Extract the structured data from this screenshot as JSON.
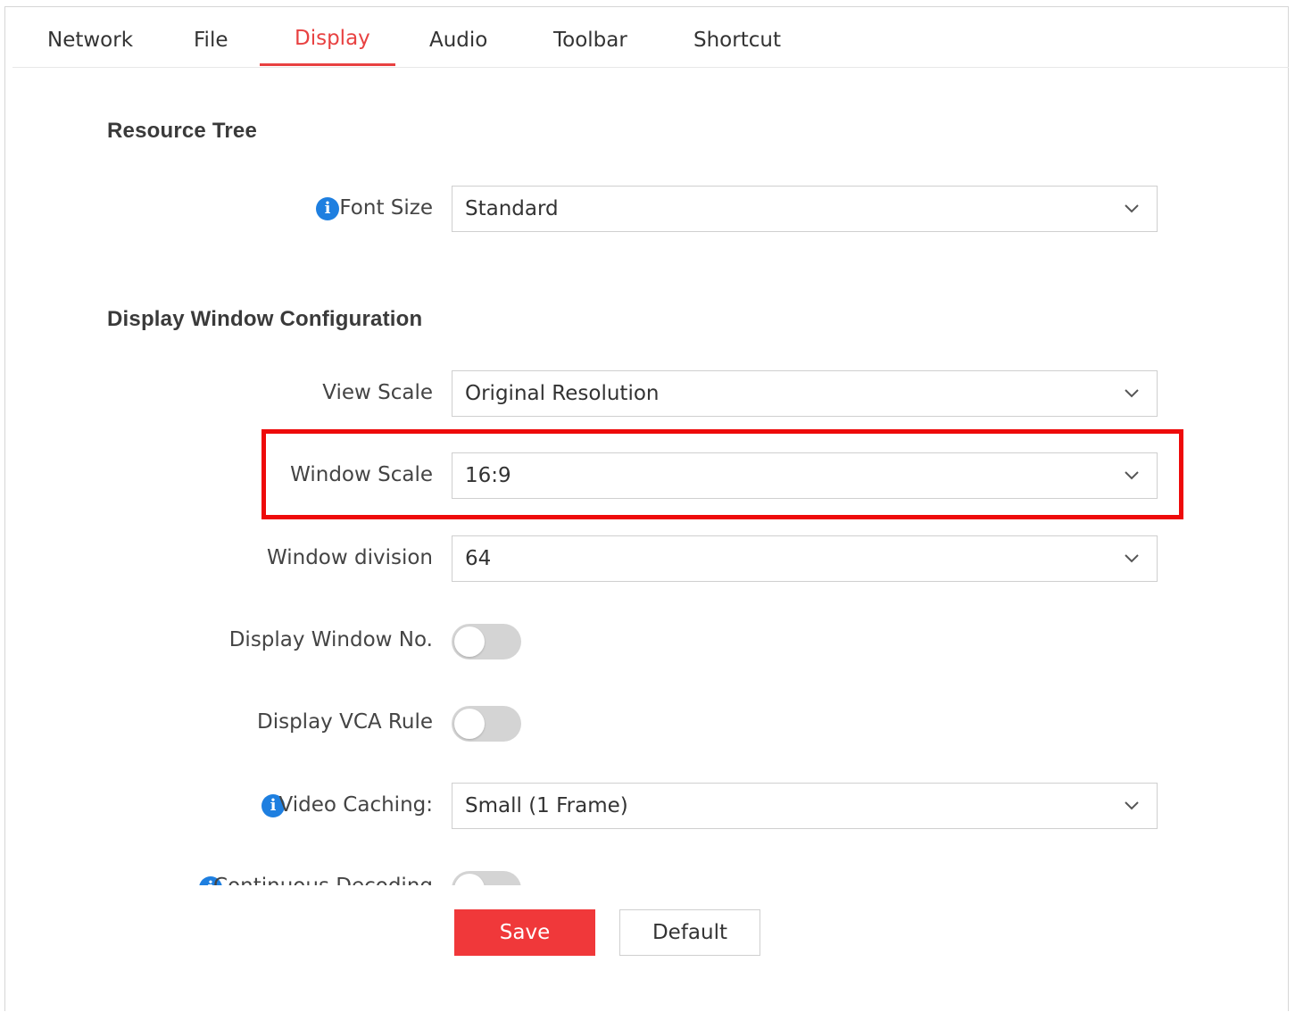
{
  "tabs": [
    {
      "label": "Network",
      "active": false
    },
    {
      "label": "File",
      "active": false
    },
    {
      "label": "Display",
      "active": true
    },
    {
      "label": "Audio",
      "active": false
    },
    {
      "label": "Toolbar",
      "active": false
    },
    {
      "label": "Shortcut",
      "active": false
    }
  ],
  "sections": {
    "resource_tree": {
      "title": "Resource Tree",
      "font_size": {
        "label": "Font Size",
        "value": "Standard"
      }
    },
    "display_window": {
      "title": "Display Window Configuration",
      "view_scale": {
        "label": "View Scale",
        "value": "Original Resolution"
      },
      "window_scale": {
        "label": "Window Scale",
        "value": "16:9"
      },
      "window_division": {
        "label": "Window division",
        "value": "64"
      },
      "display_window_no": {
        "label": "Display Window No.",
        "enabled": false
      },
      "display_vca_rule": {
        "label": "Display VCA Rule",
        "enabled": false
      },
      "video_caching": {
        "label": "Video Caching:",
        "value": "Small (1 Frame)"
      },
      "continuous_decoding": {
        "label": "Continuous Decoding",
        "enabled": false
      }
    }
  },
  "buttons": {
    "save": "Save",
    "default": "Default"
  },
  "colors": {
    "accent": "#e84141",
    "info": "#1e7fe0",
    "highlight": "#ee0a0a"
  }
}
